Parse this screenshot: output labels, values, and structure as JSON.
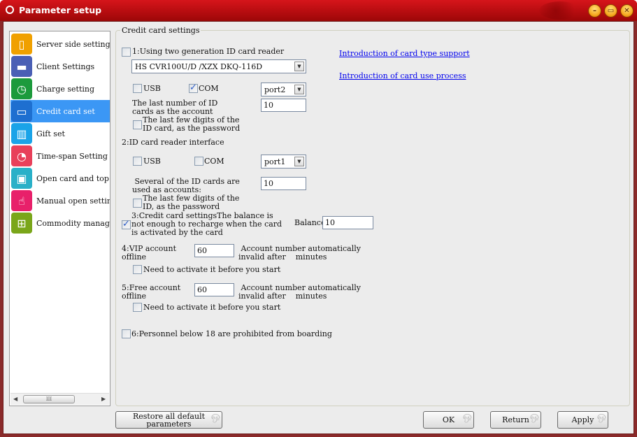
{
  "window": {
    "title": "Parameter setup",
    "controls": [
      "minimize",
      "maximize",
      "close"
    ]
  },
  "sidebar": {
    "items": [
      {
        "label": "Server side setting",
        "icon": "server-icon",
        "color": "#f0a000",
        "active": false
      },
      {
        "label": "Client Settings",
        "icon": "monitor-icon",
        "color": "#4a5fb5",
        "active": false
      },
      {
        "label": "Charge setting",
        "icon": "clock-coins-icon",
        "color": "#1c9a3c",
        "active": false
      },
      {
        "label": "Credit card set",
        "icon": "credit-card-icon",
        "color": "#1e6fd0",
        "active": true
      },
      {
        "label": "Gift set",
        "icon": "gift-icon",
        "color": "#1aa3e8",
        "active": false
      },
      {
        "label": "Time-span Setting",
        "icon": "timer-icon",
        "color": "#e8405a",
        "active": false
      },
      {
        "label": "Open card and top up",
        "icon": "id-badge-icon",
        "color": "#29b0c8",
        "active": false
      },
      {
        "label": "Manual open setting",
        "icon": "hand-pointer-icon",
        "color": "#e8206a",
        "active": false
      },
      {
        "label": "Commodity management",
        "icon": "cart-icon",
        "color": "#7aa61a",
        "active": false
      }
    ],
    "scroll_thumb_glyph": "III"
  },
  "group": {
    "legend": "Credit card settings",
    "s1": {
      "label": "1:Using two generation ID card reader",
      "checked": false,
      "reader_model": "HS CVR100U/D /XZX DKQ-116D",
      "usb_label": "USB",
      "usb_checked": false,
      "com_label": "COM",
      "com_checked": true,
      "port": "port2",
      "account_label_1": "The last number of ID",
      "account_label_2": "cards as the account",
      "account_value": "10",
      "password_label_1": "The last few digits of the",
      "password_label_2": "ID card, as the password",
      "password_checked": false
    },
    "links": {
      "card_type": "Introduction of card type support",
      "card_use": "Introduction of card use process"
    },
    "s2": {
      "label": "2:ID card reader interface",
      "usb_label": "USB",
      "usb_checked": false,
      "com_label": "COM",
      "com_checked": false,
      "port": "port1",
      "account_label_1": " Several of the ID cards are",
      "account_label_2": "used as accounts:",
      "account_value": "10",
      "password_label_1": "The last few digits of the",
      "password_label_2": "ID, as the password",
      "password_checked": false
    },
    "s3": {
      "label_1": "3:Credit card settingsThe balance is",
      "label_2": "not enough to recharge when the card",
      "label_3": "is activated by the card",
      "checked": true,
      "balance_label": "Balance",
      "balance_value": "10"
    },
    "s4": {
      "label_1": "4:VIP account",
      "label_2": "offline",
      "value": "60",
      "suffix_1": " Account number automatically",
      "suffix_2": "invalid after    minutes",
      "activate_label": "Need to activate it before you start",
      "activate_checked": false
    },
    "s5": {
      "label_1": "5:Free account",
      "label_2": "offline",
      "value": "60",
      "suffix_1": " Account number automatically",
      "suffix_2": "invalid after    minutes",
      "activate_label": "Need to activate it before you start",
      "activate_checked": false
    },
    "s6": {
      "label": "6:Personnel below 18 are prohibited from boarding",
      "checked": false
    }
  },
  "buttons": {
    "restore_1": "Restore all default",
    "restore_2": "parameters",
    "ok": "OK",
    "return": "Return",
    "apply": "Apply"
  }
}
